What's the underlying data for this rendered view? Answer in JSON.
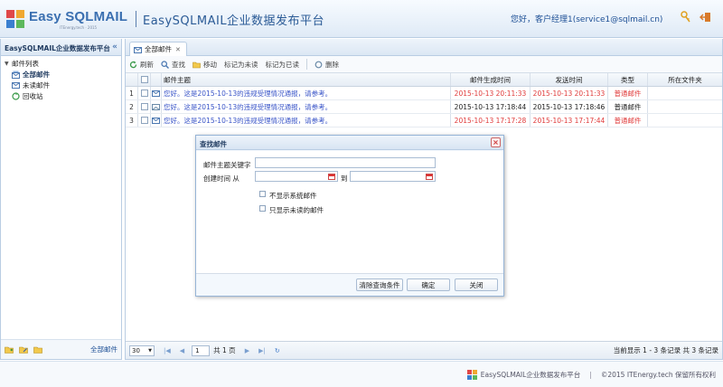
{
  "header": {
    "logo_text": "Easy SQLMAIL",
    "logo_sub": "ITEnergy.tech · 2015",
    "app_title": "EasySQLMAIL企业数据发布平台",
    "greeting": "您好，客户经理1(service1@sqlmail.cn)",
    "icons": [
      "key-icon",
      "logout-icon"
    ]
  },
  "sidebar": {
    "title": "EasySQLMAIL企业数据发布平台",
    "collapse_glyph": "«",
    "tree_root": "邮件列表",
    "items": [
      {
        "label": "全部邮件",
        "icon": "mail-stack-icon",
        "selected": true
      },
      {
        "label": "未读邮件",
        "icon": "mail-icon",
        "selected": false
      },
      {
        "label": "回收站",
        "icon": "recycle-icon",
        "selected": false
      }
    ],
    "footer_label": "全部邮件"
  },
  "main": {
    "tab_label": "全部邮件",
    "toolbar": {
      "refresh": "刷新",
      "search": "查找",
      "move": "移动",
      "mark_unread": "标记为未读",
      "mark_read": "标记为已读",
      "delete": "删除"
    },
    "columns": {
      "subject": "邮件主题",
      "generated": "邮件生成时间",
      "sent": "发送时间",
      "type": "类型",
      "folder": "所在文件夹"
    },
    "rows": [
      {
        "num": "1",
        "subject": "您好。这是2015-10-13的违规受理情况通报，请参考。",
        "generated": "2015-10-13 20:11:33",
        "sent": "2015-10-13 20:11:33",
        "type": "普通邮件",
        "folder": "",
        "gen_red": true
      },
      {
        "num": "2",
        "subject": "您好。这是2015-10-13的违规受理情况通报，请参考。",
        "generated": "2015-10-13 17:18:44",
        "sent": "2015-10-13 17:18:46",
        "type": "普通邮件",
        "folder": "",
        "gen_red": false
      },
      {
        "num": "3",
        "subject": "您好。这是2015-10-13的违规受理情况通报，请参考。",
        "generated": "2015-10-13 17:17:28",
        "sent": "2015-10-13 17:17:44",
        "type": "普通邮件",
        "folder": "",
        "gen_red": true
      }
    ],
    "pager": {
      "page_size": "30",
      "current_page": "1",
      "total_pages": "共 1 页",
      "info": "当前显示 1 - 3 条记录 共 3 条记录"
    }
  },
  "dialog": {
    "title": "查找邮件",
    "subject_keyword_label": "邮件主题关键字",
    "created_time_label": "创建时间  从",
    "to_label": "到",
    "subject_keyword_value": "",
    "date_from_value": "",
    "date_to_value": "",
    "hide_system_label": "不显示系统邮件",
    "unread_only_label": "只显示未读的邮件",
    "clear_button": "清除查询条件",
    "ok_button": "确定",
    "close_button": "关闭"
  },
  "footer": {
    "brand": "EasySQLMAIL企业数据发布平台",
    "separator": "|",
    "copyright": "©2015 ITEnergy.tech 保留所有权利"
  }
}
